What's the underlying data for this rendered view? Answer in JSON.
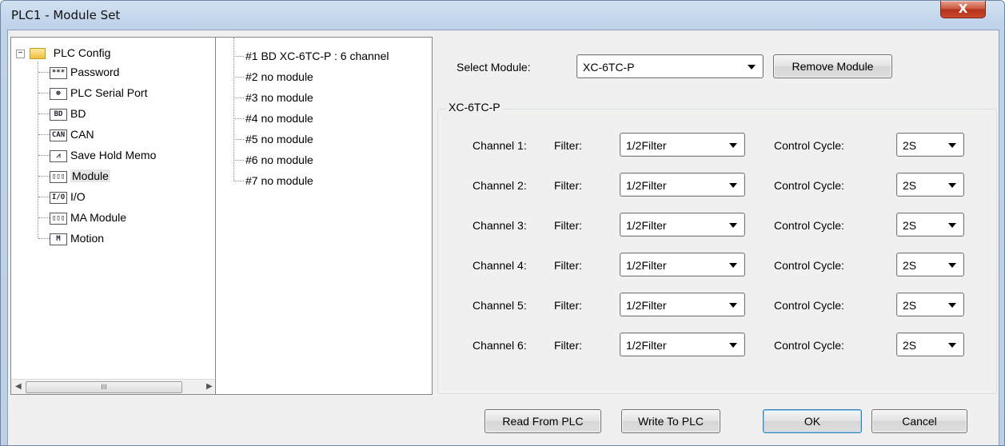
{
  "window": {
    "title": "PLC1 - Module  Set",
    "close_label": "X"
  },
  "tree": {
    "root_label": "PLC Config",
    "items": [
      {
        "label": "Password",
        "icon": "password-icon",
        "glyph": "***"
      },
      {
        "label": "PLC Serial Port",
        "icon": "serial-port-icon",
        "glyph": "⊛"
      },
      {
        "label": "BD",
        "icon": "bd-icon",
        "glyph": "BD"
      },
      {
        "label": "CAN",
        "icon": "can-icon",
        "glyph": "CAN"
      },
      {
        "label": "Save Hold Memo",
        "icon": "save-hold-memo-icon",
        "glyph": "⩘"
      },
      {
        "label": "Module",
        "icon": "module-icon",
        "glyph": "▯▯▯"
      },
      {
        "label": "I/O",
        "icon": "io-icon",
        "glyph": "I/O"
      },
      {
        "label": "MA Module",
        "icon": "ma-module-icon",
        "glyph": "▯▯▯"
      },
      {
        "label": "Motion",
        "icon": "motion-icon",
        "glyph": "M"
      }
    ],
    "selected": "Module",
    "scroll_thumb_glyph": "III"
  },
  "module_list": [
    "#1 BD XC-6TC-P : 6 channel",
    "#2 no module",
    "#3 no module",
    "#4 no module",
    "#5 no module",
    "#6 no module",
    "#7 no module"
  ],
  "select_module": {
    "label": "Select Module:",
    "value": "XC-6TC-P",
    "remove_label": "Remove Module"
  },
  "group": {
    "title": "XC-6TC-P",
    "filter_label": "Filter:",
    "cycle_label": "Control Cycle:",
    "channels": [
      {
        "label": "Channel 1:",
        "filter": "1/2Filter",
        "cycle": "2S"
      },
      {
        "label": "Channel 2:",
        "filter": "1/2Filter",
        "cycle": "2S"
      },
      {
        "label": "Channel 3:",
        "filter": "1/2Filter",
        "cycle": "2S"
      },
      {
        "label": "Channel 4:",
        "filter": "1/2Filter",
        "cycle": "2S"
      },
      {
        "label": "Channel 5:",
        "filter": "1/2Filter",
        "cycle": "2S"
      },
      {
        "label": "Channel 6:",
        "filter": "1/2Filter",
        "cycle": "2S"
      }
    ]
  },
  "buttons": {
    "read": "Read From PLC",
    "write": "Write To PLC",
    "ok": "OK",
    "cancel": "Cancel"
  }
}
